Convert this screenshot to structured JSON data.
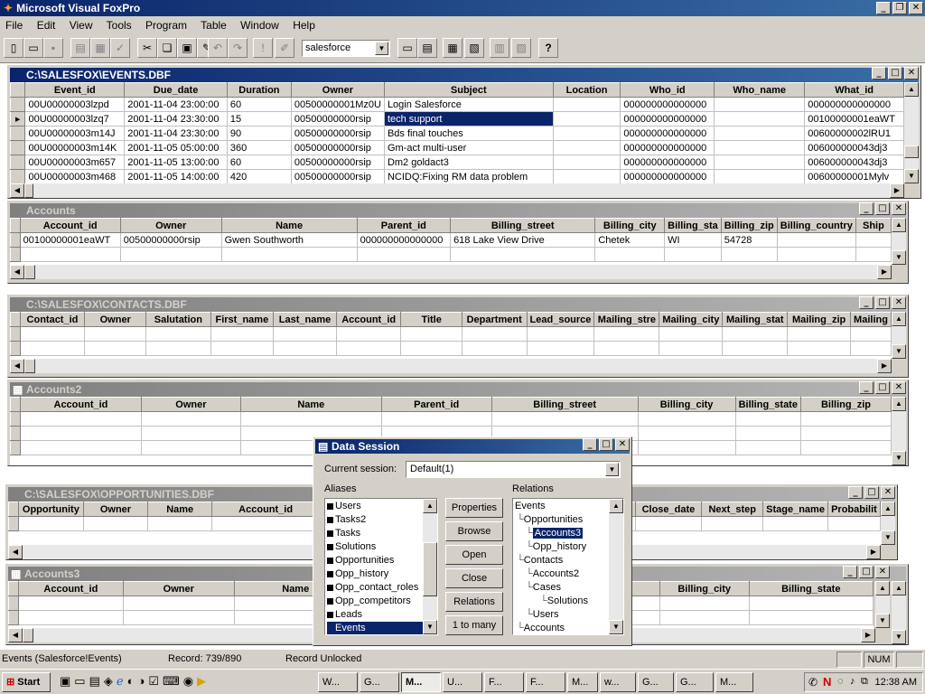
{
  "app_title": "Microsoft Visual FoxPro",
  "menu": [
    "File",
    "Edit",
    "View",
    "Tools",
    "Program",
    "Table",
    "Window",
    "Help"
  ],
  "toolbar": {
    "combo_value": "salesforce"
  },
  "events": {
    "title": "C:\\SALESFOX\\EVENTS.DBF",
    "columns": [
      "Event_id",
      "Due_date",
      "Duration",
      "Owner",
      "Subject",
      "Location",
      "Who_id",
      "Who_name",
      "What_id"
    ],
    "rows": [
      [
        "00U00000003lzpd",
        "2001-11-04 23:00:00",
        "60",
        "00500000001Mz0U",
        "Login Salesforce",
        "",
        "000000000000000",
        "",
        "000000000000000"
      ],
      [
        "00U00000003lzq7",
        "2001-11-04 23:30:00",
        "15",
        "00500000000rsip",
        "tech support",
        "",
        "000000000000000",
        "",
        "00100000001eaWT"
      ],
      [
        "00U00000003m14J",
        "2001-11-04 23:30:00",
        "90",
        "00500000000rsip",
        "Bds final touches",
        "",
        "000000000000000",
        "",
        "00600000002lRU1"
      ],
      [
        "00U00000003m14K",
        "2001-11-05 05:00:00",
        "360",
        "00500000000rsip",
        "Gm-act multi-user",
        "",
        "000000000000000",
        "",
        "006000000043dj3"
      ],
      [
        "00U00000003m657",
        "2001-11-05 13:00:00",
        "60",
        "00500000000rsip",
        "Dm2 goldact3",
        "",
        "000000000000000",
        "",
        "006000000043dj3"
      ],
      [
        "00U00000003m468",
        "2001-11-05 14:00:00",
        "420",
        "00500000000rsip",
        "NCIDQ:Fixing RM data problem",
        "",
        "000000000000000",
        "",
        "00600000001Mylv"
      ]
    ]
  },
  "accounts": {
    "title": "Accounts",
    "columns": [
      "Account_id",
      "Owner",
      "Name",
      "Parent_id",
      "Billing_street",
      "Billing_city",
      "Billing_sta",
      "Billing_zip",
      "Billing_country",
      "Ship"
    ],
    "rows": [
      [
        "00100000001eaWT",
        "00500000000rsip",
        "Gwen Southworth",
        "000000000000000",
        "618 Lake View Drive",
        "Chetek",
        "WI",
        "54728",
        "",
        ""
      ]
    ]
  },
  "contacts": {
    "title": "C:\\SALESFOX\\CONTACTS.DBF",
    "columns": [
      "Contact_id",
      "Owner",
      "Salutation",
      "First_name",
      "Last_name",
      "Account_id",
      "Title",
      "Department",
      "Lead_source",
      "Mailing_stre",
      "Mailing_city",
      "Mailing_stat",
      "Mailing_zip",
      "Mailing"
    ]
  },
  "accounts2": {
    "title": "Accounts2",
    "columns": [
      "Account_id",
      "Owner",
      "Name",
      "Parent_id",
      "Billing_street",
      "Billing_city",
      "Billing_state",
      "Billing_zip"
    ]
  },
  "opportunities": {
    "title": "C:\\SALESFOX\\OPPORTUNITIES.DBF",
    "columns": [
      "Opportunity",
      "Owner",
      "Name",
      "Account_id"
    ],
    "columns_right": [
      "nt",
      "Close_date",
      "Next_step",
      "Stage_name",
      "Probabilit"
    ]
  },
  "accounts3": {
    "title": "Accounts3",
    "columns": [
      "Account_id",
      "Owner",
      "Name"
    ],
    "columns_right": [
      "Billing_city",
      "Billing_state"
    ]
  },
  "data_session": {
    "title": "Data Session",
    "current_session_label": "Current session:",
    "current_session_value": "Default(1)",
    "aliases_label": "Aliases",
    "relations_label": "Relations",
    "aliases": [
      "Users",
      "Tasks2",
      "Tasks",
      "Solutions",
      "Opportunities",
      "Opp_history",
      "Opp_contact_roles",
      "Opp_competitors",
      "Leads",
      "Events"
    ],
    "buttons": [
      "Properties",
      "Browse",
      "Open",
      "Close",
      "Relations",
      "1 to many"
    ],
    "relations": [
      "Events",
      "Opportunities",
      "Accounts3",
      "Opp_history",
      "Contacts",
      "Accounts2",
      "Cases",
      "Solutions",
      "Users",
      "Accounts"
    ]
  },
  "status": {
    "alias": "Events (Salesforce!Events)",
    "record": "Record: 739/890",
    "lock": "Record Unlocked",
    "num": "NUM"
  },
  "taskbar": {
    "start": "Start",
    "buttons": [
      "W...",
      "G...",
      "M...",
      "U...",
      "F...",
      "F...",
      "M...",
      "w...",
      "G...",
      "G...",
      "M..."
    ],
    "clock": "12:38 AM"
  }
}
